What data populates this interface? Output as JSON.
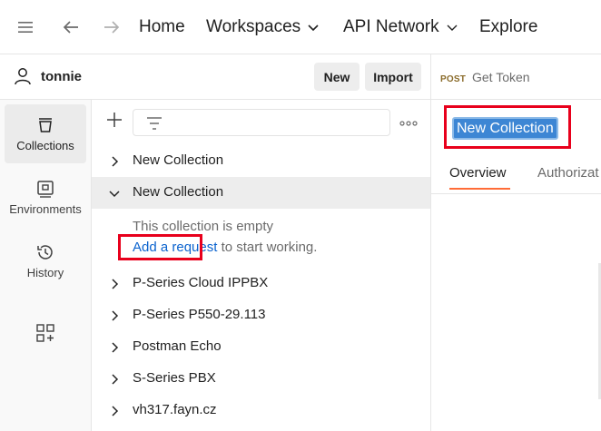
{
  "topbar": {
    "home": "Home",
    "workspaces": "Workspaces",
    "api_network": "API Network",
    "explore": "Explore"
  },
  "user": {
    "name": "tonnie",
    "new_label": "New",
    "import_label": "Import"
  },
  "rail": {
    "items": [
      {
        "label": "Collections",
        "icon": "collections-icon",
        "active": true
      },
      {
        "label": "Environments",
        "icon": "environments-icon",
        "active": false
      },
      {
        "label": "History",
        "icon": "history-icon",
        "active": false
      }
    ]
  },
  "collections": {
    "items": [
      {
        "label": "New Collection",
        "expanded": false
      },
      {
        "label": "New Collection",
        "expanded": true
      },
      {
        "label": "P-Series Cloud IPPBX",
        "expanded": false
      },
      {
        "label": "P-Series P550-29.113",
        "expanded": false
      },
      {
        "label": "Postman Echo",
        "expanded": false
      },
      {
        "label": "S-Series PBX",
        "expanded": false
      },
      {
        "label": "vh317.fayn.cz",
        "expanded": false
      }
    ],
    "empty_text": "This collection is empty",
    "add_request_link": "Add a request",
    "add_request_suffix": " to start working."
  },
  "right_pane": {
    "request_method": "POST",
    "request_name": "Get Token",
    "collection_title": "New Collection",
    "tabs": [
      "Overview",
      "Authorizat"
    ]
  },
  "colors": {
    "accent_tab": "#ff6c37",
    "link": "#0b63ce",
    "selection": "#3d86d4",
    "annotation": "#e8001c"
  }
}
